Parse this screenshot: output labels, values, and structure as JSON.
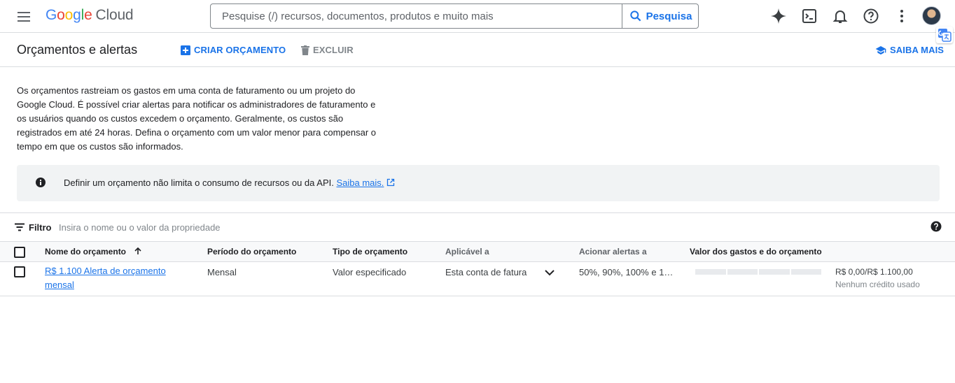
{
  "header": {
    "logo": {
      "g": "G",
      "o1": "o",
      "o2": "o",
      "g2": "g",
      "l": "l",
      "e": "e",
      "product": "Cloud"
    },
    "search": {
      "placeholder": "Pesquise (/) recursos, documentos, produtos e muito mais",
      "button_label": "Pesquisa"
    },
    "icons": [
      "menu-icon",
      "gemini-sparkle-icon",
      "cloud-shell-icon",
      "bell-icon",
      "help-icon",
      "more-vert-icon",
      "avatar",
      "translate-icon"
    ]
  },
  "page": {
    "title": "Orçamentos e alertas",
    "create_label": "CRIAR ORÇAMENTO",
    "delete_label": "EXCLUIR",
    "learn_more_label": "SAIBA MAIS"
  },
  "intro": {
    "text": "Os orçamentos rastreiam os gastos em uma conta de faturamento ou um projeto do Google Cloud. É possível criar alertas para notificar os administradores de faturamento e os usuários quando os custos excedem o orçamento. Geralmente, os custos são registrados em até 24 horas. Defina o orçamento com um valor menor para compensar o tempo em que os custos são informados."
  },
  "notice": {
    "text": "Definir um orçamento não limita o consumo de recursos ou da API.",
    "link": "Saiba mais."
  },
  "filter": {
    "label": "Filtro",
    "placeholder": "Insira o nome ou o valor da propriedade"
  },
  "table": {
    "columns": [
      "Nome do orçamento",
      "Período do orçamento",
      "Tipo de orçamento",
      "Aplicável a",
      "Acionar alertas a",
      "Valor dos gastos e do orçamento"
    ],
    "rows": [
      {
        "name_line1": "R$ 1.100 Alerta de orçamento",
        "name_line2": "mensal",
        "period": "Mensal",
        "type": "Valor especificado",
        "applies_to": "Esta conta de fatura",
        "alerts": "50%, 90%, 100% e 1…",
        "spend": "R$ 0,00/R$ 1.100,00",
        "credit": "Nenhum crédito usado",
        "spend_fraction": 0
      }
    ]
  },
  "colors": {
    "accent": "#1a73e8",
    "text": "#202124",
    "muted": "#5f6368",
    "border": "#dadce0"
  }
}
